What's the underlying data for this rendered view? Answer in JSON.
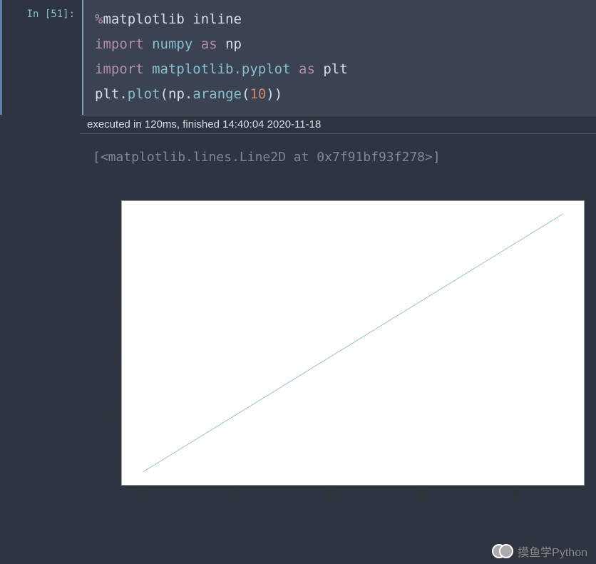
{
  "prompt": "In [51]:",
  "code": {
    "l1": {
      "magic": "%",
      "text": "matplotlib inline"
    },
    "l2": {
      "kw1": "import",
      "mod": "numpy",
      "kw2": "as",
      "alias": "np"
    },
    "l3": {
      "kw1": "import",
      "mod": "matplotlib.pyplot",
      "kw2": "as",
      "alias": "plt"
    },
    "l4": {
      "obj1": "plt",
      "fn1": "plot",
      "obj2": "np",
      "fn2": "arange",
      "arg": "10"
    }
  },
  "exec_status": "executed in 120ms, finished 14:40:04 2020-11-18",
  "output_repr": "[<matplotlib.lines.Line2D at 0x7f91bf93f278>]",
  "watermark": "摸鱼学Python",
  "chart_data": {
    "type": "line",
    "x": [
      0,
      1,
      2,
      3,
      4,
      5,
      6,
      7,
      8,
      9
    ],
    "y": [
      0,
      1,
      2,
      3,
      4,
      5,
      6,
      7,
      8,
      9
    ],
    "series_name": "np.arange(10)",
    "xlabel": "",
    "ylabel": "",
    "title": "",
    "xticks": [
      0,
      2,
      4,
      6,
      8
    ],
    "yticks": [
      0,
      2,
      4,
      6,
      8
    ],
    "xlim": [
      -0.45,
      9.45
    ],
    "ylim": [
      -0.45,
      9.45
    ],
    "line_color": "#1f77b4"
  }
}
